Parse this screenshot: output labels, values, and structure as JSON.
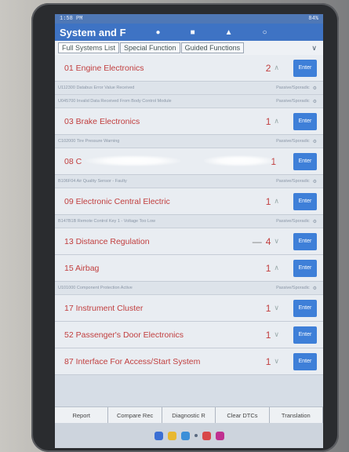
{
  "status_bar": {
    "time": "1:58 PM",
    "battery": "84%"
  },
  "app": {
    "title": "System and F",
    "icons": [
      "home-icon",
      "document-icon",
      "person-icon",
      "user-icon"
    ]
  },
  "tabs": [
    {
      "label": "Full Systems List",
      "active": true
    },
    {
      "label": "Special Function",
      "active": false
    },
    {
      "label": "Guided Functions",
      "active": false
    }
  ],
  "enter_label": "Enter",
  "systems": [
    {
      "name": "01 Engine Electronics",
      "count": "2",
      "arrow": "up",
      "enter": true,
      "dtcs": [
        {
          "text": "U112300 Databus Error Value Received",
          "status": "Passive/Sporadic"
        },
        {
          "text": "U045700 Invalid Data Received From Body Control Module",
          "status": "Passive/Sporadic"
        }
      ]
    },
    {
      "name": "03 Brake Electronics",
      "count": "1",
      "arrow": "up",
      "enter": true,
      "dtcs": [
        {
          "text": "C102000 Tire Pressure Warning",
          "status": "Passive/Sporadic"
        }
      ]
    },
    {
      "name": "08 C",
      "count": "1",
      "arrow": "",
      "enter": true,
      "glare": true,
      "dtcs": [
        {
          "text": "B106F04 Air Quality Sensor - Faulty",
          "status": "Passive/Sporadic"
        }
      ]
    },
    {
      "name": "09 Electronic Central Electric",
      "count": "1",
      "arrow": "up",
      "enter": true,
      "dtcs": [
        {
          "text": "B147B1B Remote Control Key 1 - Voltage Too Low",
          "status": "Passive/Sporadic"
        }
      ]
    },
    {
      "name": "13 Distance Regulation",
      "count": "4",
      "arrow": "down",
      "enter": true,
      "dash": "—",
      "dtcs": []
    },
    {
      "name": "15 Airbag",
      "count": "1",
      "arrow": "up",
      "enter": true,
      "dtcs": [
        {
          "text": "U101000 Component Protection Active",
          "status": "Passive/Sporadic"
        }
      ]
    },
    {
      "name": "17 Instrument Cluster",
      "count": "1",
      "arrow": "down",
      "enter": true,
      "dtcs": []
    },
    {
      "name": "52 Passenger's Door Electronics",
      "count": "1",
      "arrow": "down",
      "enter": true,
      "dtcs": []
    },
    {
      "name": "87 Interface For Access/Start System",
      "count": "1",
      "arrow": "down",
      "enter": true,
      "dtcs": []
    }
  ],
  "bottom_buttons": [
    "Report",
    "Compare Rec",
    "Diagnostic R",
    "Clear DTCs",
    "Translation"
  ],
  "dock_colors": [
    "#3b6fd4",
    "#e8b830",
    "#3b8fd8",
    "#d84848",
    "#c03090"
  ]
}
